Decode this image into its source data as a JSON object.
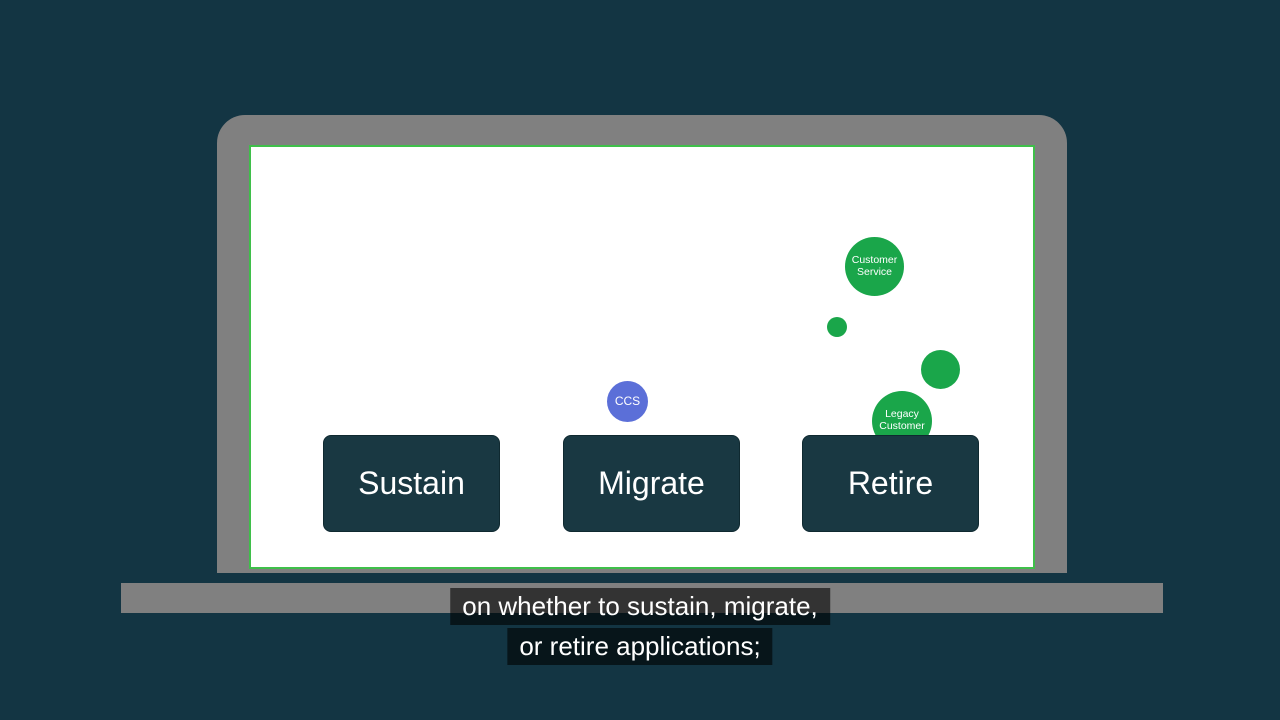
{
  "cards": {
    "sustain": "Sustain",
    "migrate": "Migrate",
    "retire": "Retire"
  },
  "bubbles": {
    "ccs": "CCS",
    "customer_service_l1": "Customer",
    "customer_service_l2": "Service",
    "legacy_l1": "Legacy",
    "legacy_l2": "Customer"
  },
  "caption": {
    "line1": "on whether to sustain, migrate,",
    "line2": "or retire applications;"
  },
  "colors": {
    "page_bg": "#133543",
    "laptop_frame": "#808080",
    "screen_border": "#3fbf4a",
    "card_bg": "#193842",
    "bubble_blue": "#5b6fd8",
    "bubble_green": "#1aa64a"
  }
}
